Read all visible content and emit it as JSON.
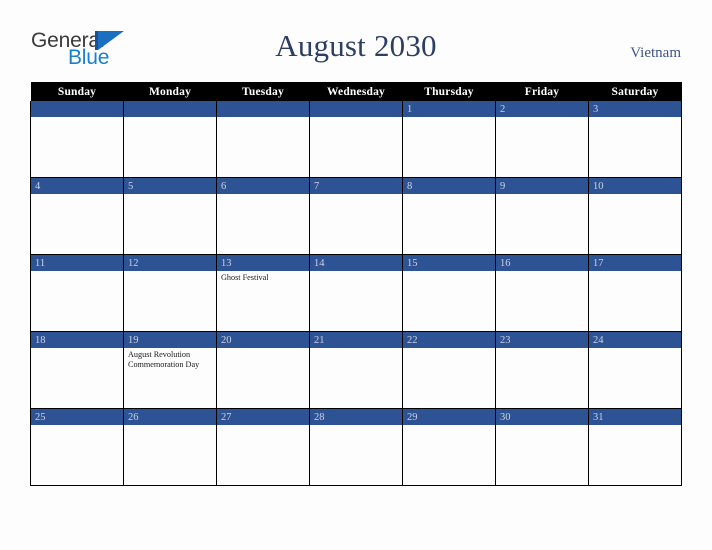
{
  "brand": {
    "name_part1": "General",
    "name_part2": "Blue",
    "logo_icon": "blue-triangle-icon",
    "color_dark": "#3b3b3b",
    "color_blue": "#1b7fd0"
  },
  "header": {
    "title": "August 2030",
    "country": "Vietnam",
    "title_color": "#2d3e63",
    "country_color": "#3f5585"
  },
  "calendar": {
    "month": "August",
    "year": "2030",
    "accent_color": "#2e5395",
    "header_bg": "#000000",
    "weekday_headers": [
      "Sunday",
      "Monday",
      "Tuesday",
      "Wednesday",
      "Thursday",
      "Friday",
      "Saturday"
    ],
    "weeks": [
      [
        {
          "date": "",
          "events": []
        },
        {
          "date": "",
          "events": []
        },
        {
          "date": "",
          "events": []
        },
        {
          "date": "",
          "events": []
        },
        {
          "date": "1",
          "events": []
        },
        {
          "date": "2",
          "events": []
        },
        {
          "date": "3",
          "events": []
        }
      ],
      [
        {
          "date": "4",
          "events": []
        },
        {
          "date": "5",
          "events": []
        },
        {
          "date": "6",
          "events": []
        },
        {
          "date": "7",
          "events": []
        },
        {
          "date": "8",
          "events": []
        },
        {
          "date": "9",
          "events": []
        },
        {
          "date": "10",
          "events": []
        }
      ],
      [
        {
          "date": "11",
          "events": []
        },
        {
          "date": "12",
          "events": []
        },
        {
          "date": "13",
          "events": [
            "Ghost Festival"
          ]
        },
        {
          "date": "14",
          "events": []
        },
        {
          "date": "15",
          "events": []
        },
        {
          "date": "16",
          "events": []
        },
        {
          "date": "17",
          "events": []
        }
      ],
      [
        {
          "date": "18",
          "events": []
        },
        {
          "date": "19",
          "events": [
            "August Revolution Commemoration Day"
          ]
        },
        {
          "date": "20",
          "events": []
        },
        {
          "date": "21",
          "events": []
        },
        {
          "date": "22",
          "events": []
        },
        {
          "date": "23",
          "events": []
        },
        {
          "date": "24",
          "events": []
        }
      ],
      [
        {
          "date": "25",
          "events": []
        },
        {
          "date": "26",
          "events": []
        },
        {
          "date": "27",
          "events": []
        },
        {
          "date": "28",
          "events": []
        },
        {
          "date": "29",
          "events": []
        },
        {
          "date": "30",
          "events": []
        },
        {
          "date": "31",
          "events": []
        }
      ]
    ]
  }
}
